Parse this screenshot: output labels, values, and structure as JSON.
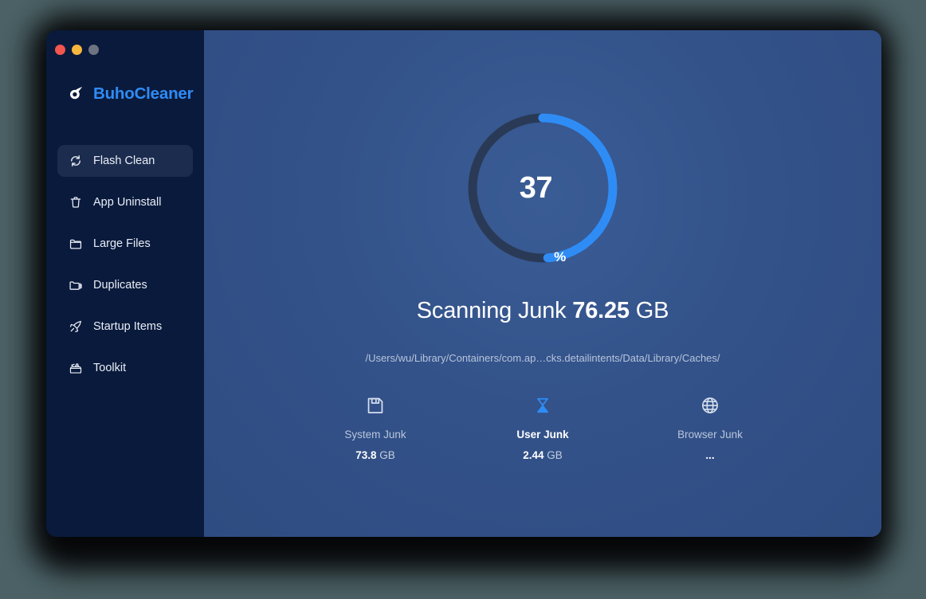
{
  "window": {
    "traffic_lights": [
      {
        "name": "close",
        "color": "#f4564d"
      },
      {
        "name": "minimize",
        "color": "#f6b73c"
      },
      {
        "name": "maximize",
        "color": "#6d7480"
      }
    ]
  },
  "sidebar": {
    "brand": {
      "name": "BuhoCleaner",
      "logo_icon": "buho-owl-swirl-icon",
      "color": "#2f8cf5"
    },
    "items": [
      {
        "label": "Flash Clean",
        "icon": "refresh-cycle-icon",
        "active": true
      },
      {
        "label": "App Uninstall",
        "icon": "trash-can-icon",
        "active": false
      },
      {
        "label": "Large Files",
        "icon": "folder-icon",
        "active": false
      },
      {
        "label": "Duplicates",
        "icon": "folders-stack-icon",
        "active": false
      },
      {
        "label": "Startup Items",
        "icon": "rocket-icon",
        "active": false
      },
      {
        "label": "Toolkit",
        "icon": "toolbox-icon",
        "active": false
      }
    ]
  },
  "main": {
    "progress": {
      "percent_value": "37",
      "percent_symbol": "%",
      "percent_number": 37,
      "track_color": "#2a3a56",
      "arc_color": "#2f8cf5"
    },
    "headline": {
      "prefix": "Scanning Junk ",
      "size_number": "76.25",
      "size_unit": " GB"
    },
    "scan_path": "/Users/wu/Library/Containers/com.ap…cks.detailintents/Data/Library/Caches/",
    "categories": [
      {
        "label": "System Junk",
        "icon": "floppy-disk-icon",
        "value_number": "73.8",
        "value_unit": " GB",
        "active": false
      },
      {
        "label": "User Junk",
        "icon": "hourglass-icon",
        "value_number": "2.44",
        "value_unit": " GB",
        "active": true
      },
      {
        "label": "Browser Junk",
        "icon": "globe-icon",
        "value_number": "...",
        "value_unit": "",
        "active": false
      }
    ]
  },
  "colors": {
    "desktop_bg": "#4b6165",
    "sidebar_bg": "#0a1a3c",
    "sidebar_active_bg": "#1c2c4e",
    "main_bg": "#33528a",
    "accent": "#2f8cf5"
  }
}
